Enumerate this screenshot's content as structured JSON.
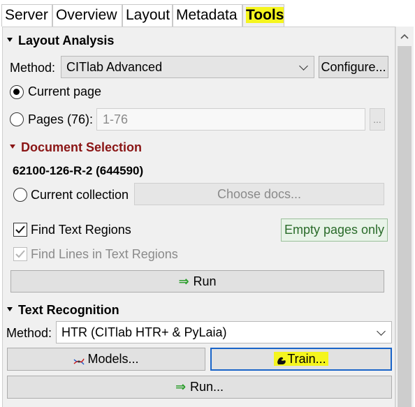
{
  "tabs": [
    {
      "label": "Server"
    },
    {
      "label": "Overview"
    },
    {
      "label": "Layout"
    },
    {
      "label": "Metadata"
    },
    {
      "label": "Tools"
    }
  ],
  "layout_analysis": {
    "title": "Layout Analysis",
    "method_label": "Method:",
    "method_value": "CITlab Advanced",
    "configure_label": "Configure...",
    "current_page_label": "Current page",
    "pages_label": "Pages (76):",
    "pages_value": "1-76",
    "ellipsis_label": "..."
  },
  "document_selection": {
    "title": "Document Selection",
    "doc_id": "62100-126-R-2 (644590)",
    "current_collection_label": "Current collection",
    "choose_docs_label": "Choose docs..."
  },
  "options": {
    "find_text_regions_label": "Find Text Regions",
    "empty_pages_label": "Empty pages only",
    "find_lines_label": "Find Lines in Text Regions",
    "run_label": "Run"
  },
  "text_recognition": {
    "title": "Text Recognition",
    "method_label": "Method:",
    "method_value": "HTR (CITlab HTR+ & PyLaia)",
    "models_label": "Models...",
    "train_label": "Train...",
    "run_label": "Run..."
  },
  "colors": {
    "highlight": "#f5f51e",
    "section_red": "#8a1515",
    "run_arrow": "#2a9d2a",
    "focus_border": "#1a64c8"
  }
}
